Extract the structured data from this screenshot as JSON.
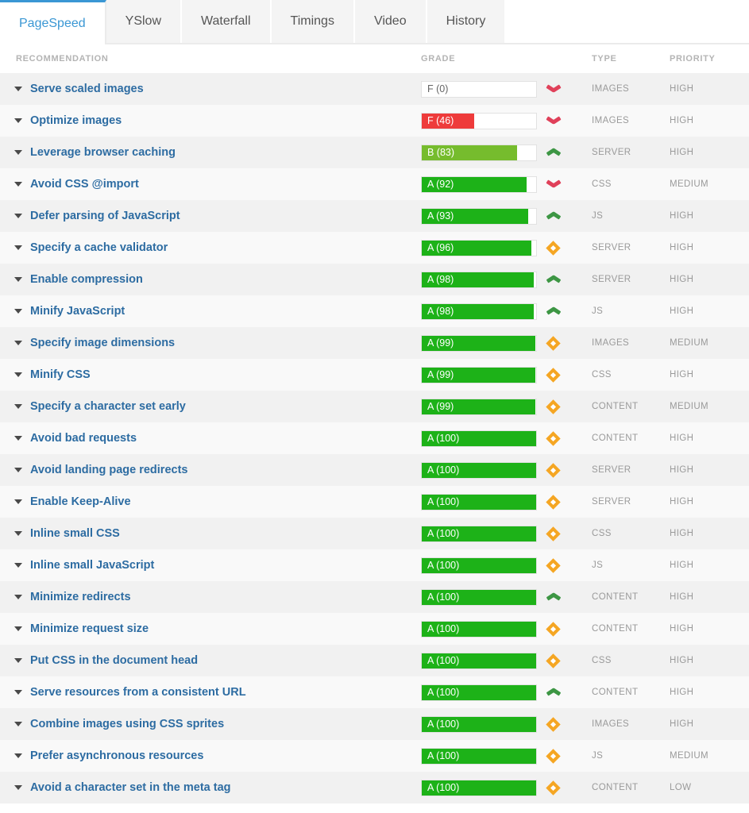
{
  "tabs": [
    {
      "label": "PageSpeed",
      "active": true
    },
    {
      "label": "YSlow",
      "active": false
    },
    {
      "label": "Waterfall",
      "active": false
    },
    {
      "label": "Timings",
      "active": false
    },
    {
      "label": "Video",
      "active": false
    },
    {
      "label": "History",
      "active": false
    }
  ],
  "columns": {
    "recommendation": "RECOMMENDATION",
    "grade": "GRADE",
    "type": "TYPE",
    "priority": "PRIORITY"
  },
  "colors": {
    "accent": "#3a97d4",
    "link": "#2d6ca2",
    "grade_f": "#ee3b3b",
    "grade_b": "#76bc2d",
    "grade_a": "#1db218",
    "trend_down": "#e0415a",
    "trend_up": "#3d9644",
    "trend_same": "#f5a623",
    "row_odd": "#f1f1f1",
    "row_even": "#f9f9f9",
    "meta_text": "#9a9a9a"
  },
  "rows": [
    {
      "recommendation": "Serve scaled images",
      "grade": "F (0)",
      "score": 0,
      "grade_letter": "F",
      "trend": "down",
      "type": "IMAGES",
      "priority": "HIGH"
    },
    {
      "recommendation": "Optimize images",
      "grade": "F (46)",
      "score": 46,
      "grade_letter": "F",
      "trend": "down",
      "type": "IMAGES",
      "priority": "HIGH"
    },
    {
      "recommendation": "Leverage browser caching",
      "grade": "B (83)",
      "score": 83,
      "grade_letter": "B",
      "trend": "up",
      "type": "SERVER",
      "priority": "HIGH"
    },
    {
      "recommendation": "Avoid CSS @import",
      "grade": "A (92)",
      "score": 92,
      "grade_letter": "A",
      "trend": "down",
      "type": "CSS",
      "priority": "MEDIUM"
    },
    {
      "recommendation": "Defer parsing of JavaScript",
      "grade": "A (93)",
      "score": 93,
      "grade_letter": "A",
      "trend": "up",
      "type": "JS",
      "priority": "HIGH"
    },
    {
      "recommendation": "Specify a cache validator",
      "grade": "A (96)",
      "score": 96,
      "grade_letter": "A",
      "trend": "same",
      "type": "SERVER",
      "priority": "HIGH"
    },
    {
      "recommendation": "Enable compression",
      "grade": "A (98)",
      "score": 98,
      "grade_letter": "A",
      "trend": "up",
      "type": "SERVER",
      "priority": "HIGH"
    },
    {
      "recommendation": "Minify JavaScript",
      "grade": "A (98)",
      "score": 98,
      "grade_letter": "A",
      "trend": "up",
      "type": "JS",
      "priority": "HIGH"
    },
    {
      "recommendation": "Specify image dimensions",
      "grade": "A (99)",
      "score": 99,
      "grade_letter": "A",
      "trend": "same",
      "type": "IMAGES",
      "priority": "MEDIUM"
    },
    {
      "recommendation": "Minify CSS",
      "grade": "A (99)",
      "score": 99,
      "grade_letter": "A",
      "trend": "same",
      "type": "CSS",
      "priority": "HIGH"
    },
    {
      "recommendation": "Specify a character set early",
      "grade": "A (99)",
      "score": 99,
      "grade_letter": "A",
      "trend": "same",
      "type": "CONTENT",
      "priority": "MEDIUM"
    },
    {
      "recommendation": "Avoid bad requests",
      "grade": "A (100)",
      "score": 100,
      "grade_letter": "A",
      "trend": "same",
      "type": "CONTENT",
      "priority": "HIGH"
    },
    {
      "recommendation": "Avoid landing page redirects",
      "grade": "A (100)",
      "score": 100,
      "grade_letter": "A",
      "trend": "same",
      "type": "SERVER",
      "priority": "HIGH"
    },
    {
      "recommendation": "Enable Keep-Alive",
      "grade": "A (100)",
      "score": 100,
      "grade_letter": "A",
      "trend": "same",
      "type": "SERVER",
      "priority": "HIGH"
    },
    {
      "recommendation": "Inline small CSS",
      "grade": "A (100)",
      "score": 100,
      "grade_letter": "A",
      "trend": "same",
      "type": "CSS",
      "priority": "HIGH"
    },
    {
      "recommendation": "Inline small JavaScript",
      "grade": "A (100)",
      "score": 100,
      "grade_letter": "A",
      "trend": "same",
      "type": "JS",
      "priority": "HIGH"
    },
    {
      "recommendation": "Minimize redirects",
      "grade": "A (100)",
      "score": 100,
      "grade_letter": "A",
      "trend": "up",
      "type": "CONTENT",
      "priority": "HIGH"
    },
    {
      "recommendation": "Minimize request size",
      "grade": "A (100)",
      "score": 100,
      "grade_letter": "A",
      "trend": "same",
      "type": "CONTENT",
      "priority": "HIGH"
    },
    {
      "recommendation": "Put CSS in the document head",
      "grade": "A (100)",
      "score": 100,
      "grade_letter": "A",
      "trend": "same",
      "type": "CSS",
      "priority": "HIGH"
    },
    {
      "recommendation": "Serve resources from a consistent URL",
      "grade": "A (100)",
      "score": 100,
      "grade_letter": "A",
      "trend": "up",
      "type": "CONTENT",
      "priority": "HIGH"
    },
    {
      "recommendation": "Combine images using CSS sprites",
      "grade": "A (100)",
      "score": 100,
      "grade_letter": "A",
      "trend": "same",
      "type": "IMAGES",
      "priority": "HIGH"
    },
    {
      "recommendation": "Prefer asynchronous resources",
      "grade": "A (100)",
      "score": 100,
      "grade_letter": "A",
      "trend": "same",
      "type": "JS",
      "priority": "MEDIUM"
    },
    {
      "recommendation": "Avoid a character set in the meta tag",
      "grade": "A (100)",
      "score": 100,
      "grade_letter": "A",
      "trend": "same",
      "type": "CONTENT",
      "priority": "LOW"
    }
  ]
}
